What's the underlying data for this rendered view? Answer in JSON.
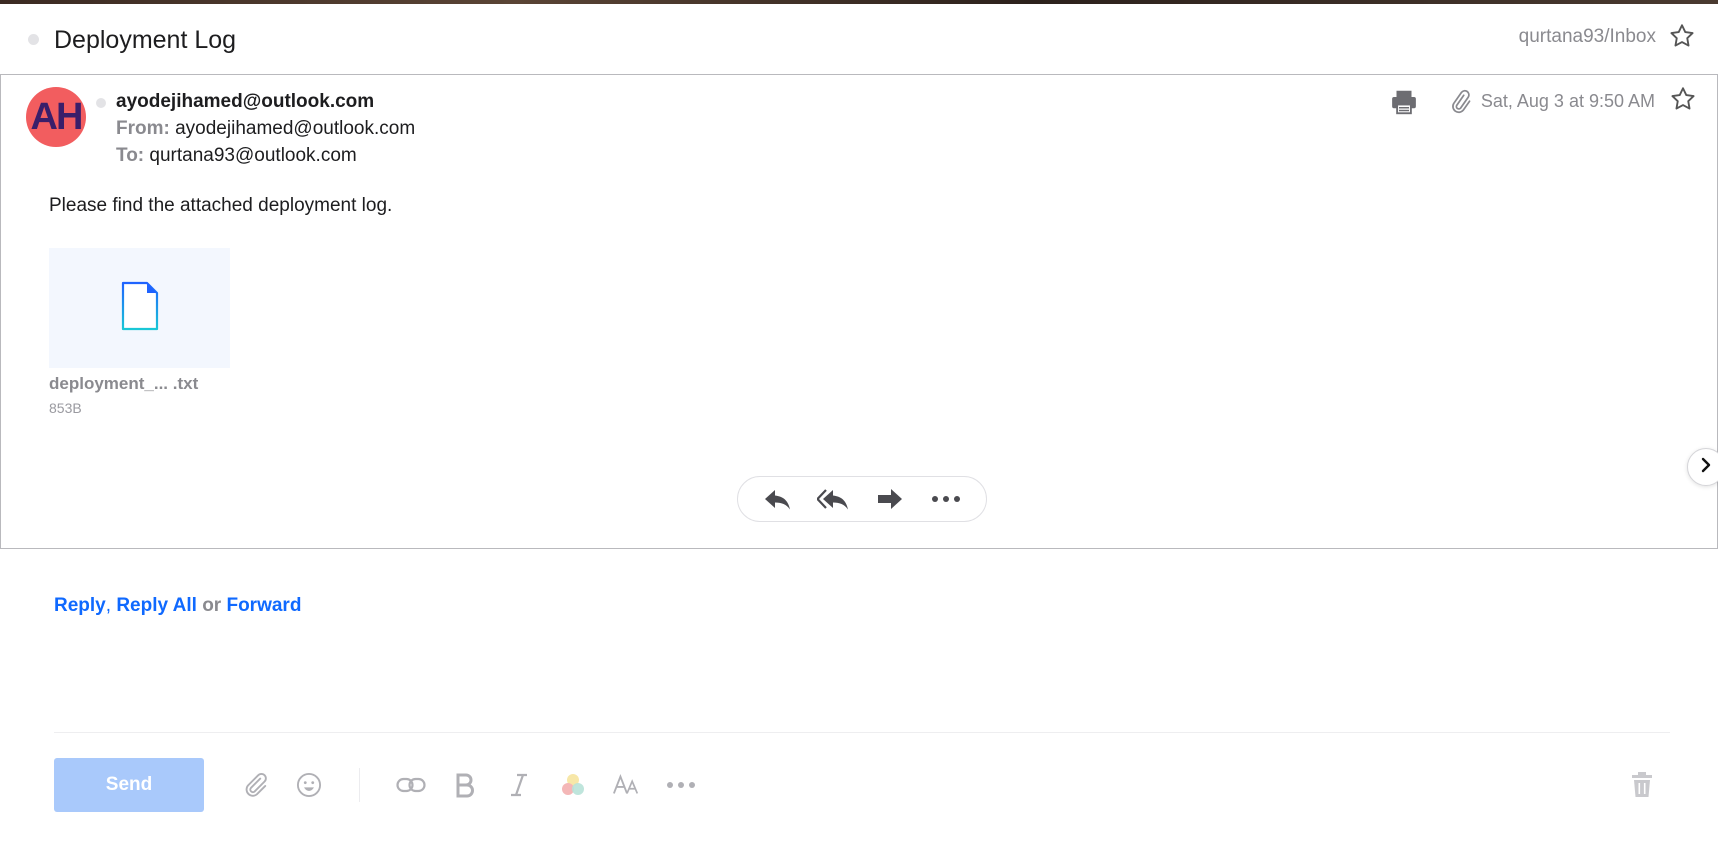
{
  "header": {
    "subject": "Deployment Log",
    "folder_path": "qurtana93/Inbox"
  },
  "message": {
    "avatar_initials": "AH",
    "sender": "ayodejihamed@outlook.com",
    "from_label": "From:",
    "from_value": "ayodejihamed@outlook.com",
    "to_label": "To:",
    "to_value": "qurtana93@outlook.com",
    "date": "Sat, Aug 3 at 9:50 AM",
    "body": "Please find the attached deployment log.",
    "attachment": {
      "name": "deployment_... .txt",
      "size": "853B"
    }
  },
  "reply_bar": {
    "reply": "Reply",
    "comma": ",",
    "reply_all": "Reply All",
    "or": "or",
    "forward": "Forward"
  },
  "compose": {
    "send_label": "Send"
  },
  "colors": {
    "accent": "#0f69ff",
    "avatar_bg": "#f25d5f",
    "send_disabled": "#a9c9fb"
  }
}
